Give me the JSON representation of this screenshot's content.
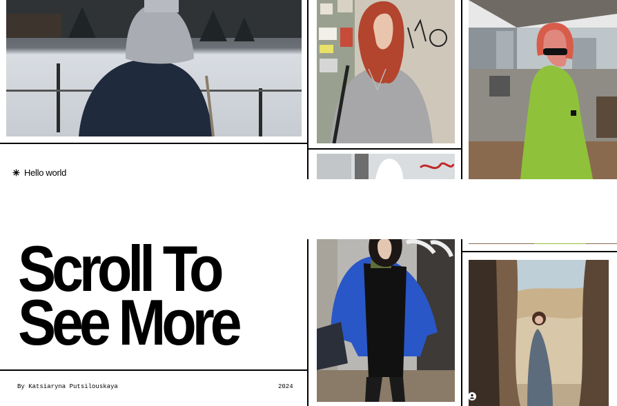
{
  "hello": {
    "text": "Hello world",
    "icon": "asterisk-icon"
  },
  "hero": {
    "line1": "Scroll To",
    "line2": "See More"
  },
  "footer": {
    "credit": "By Katsiaryna Putsilouskaya",
    "year": "2024"
  },
  "colors": {
    "background": "#ffffff",
    "text": "#000000",
    "rule": "#000000"
  }
}
